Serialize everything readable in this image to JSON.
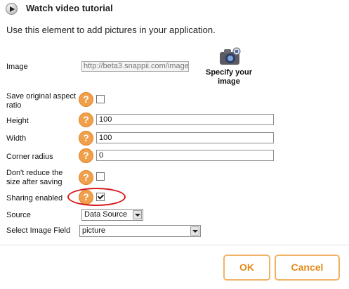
{
  "header": {
    "title": "Watch video tutorial"
  },
  "intro": "Use this element to add pictures in your application.",
  "image": {
    "label": "Image",
    "url": "http://beta3.snappii.com/image",
    "specify_label": "Specify your image"
  },
  "fields": {
    "save_aspect_label": "Save original aspect ratio",
    "save_aspect_checked": false,
    "height_label": "Height",
    "height_value": "100",
    "width_label": "Width",
    "width_value": "100",
    "corner_label": "Corner radius",
    "corner_value": "0",
    "no_reduce_label": "Don't reduce the size after saving",
    "no_reduce_checked": false,
    "sharing_label": "Sharing enabled",
    "sharing_checked": true,
    "source_label": "Source",
    "source_value": "Data Source",
    "image_field_label": "Select Image Field",
    "image_field_value": "picture"
  },
  "help_glyph": "?",
  "footer": {
    "ok_label": "OK",
    "cancel_label": "Cancel"
  },
  "colors": {
    "accent": "#f0a04a",
    "button_text": "#e58a1c",
    "highlight": "#d8171b"
  }
}
